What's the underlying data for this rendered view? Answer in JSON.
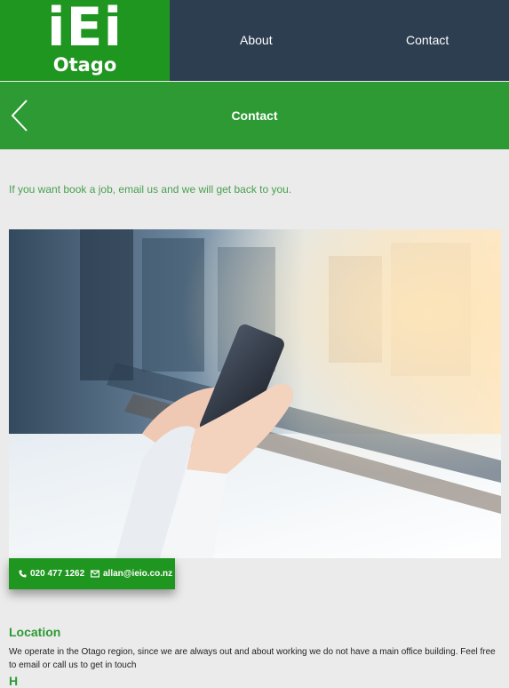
{
  "header": {
    "logo_mark": "iEi",
    "logo_sub": "Otago",
    "nav": [
      {
        "label": "About"
      },
      {
        "label": "Contact"
      }
    ]
  },
  "titlebar": {
    "title": "Contact",
    "back_icon": "chevron-left-icon"
  },
  "intro": "If you want book a job, email us and we will get back to you.",
  "hero_image": {
    "description_icon": "hero-photo"
  },
  "contact": {
    "phone": "020 477 1262",
    "email": "allan@ieio.co.nz",
    "phone_icon": "phone-icon",
    "email_icon": "envelope-icon"
  },
  "location": {
    "heading": "Location",
    "text": "We operate in the Otago region, since we are always out and about working we do not have a main office building. Feel free to email or call us to get in touch"
  },
  "next_section": {
    "heading": "H"
  },
  "colors": {
    "logo_green": "#1f961f",
    "titlebar_green": "#2d9a34",
    "nav_bg": "#2c3e50",
    "page_bg": "#ebebeb"
  }
}
